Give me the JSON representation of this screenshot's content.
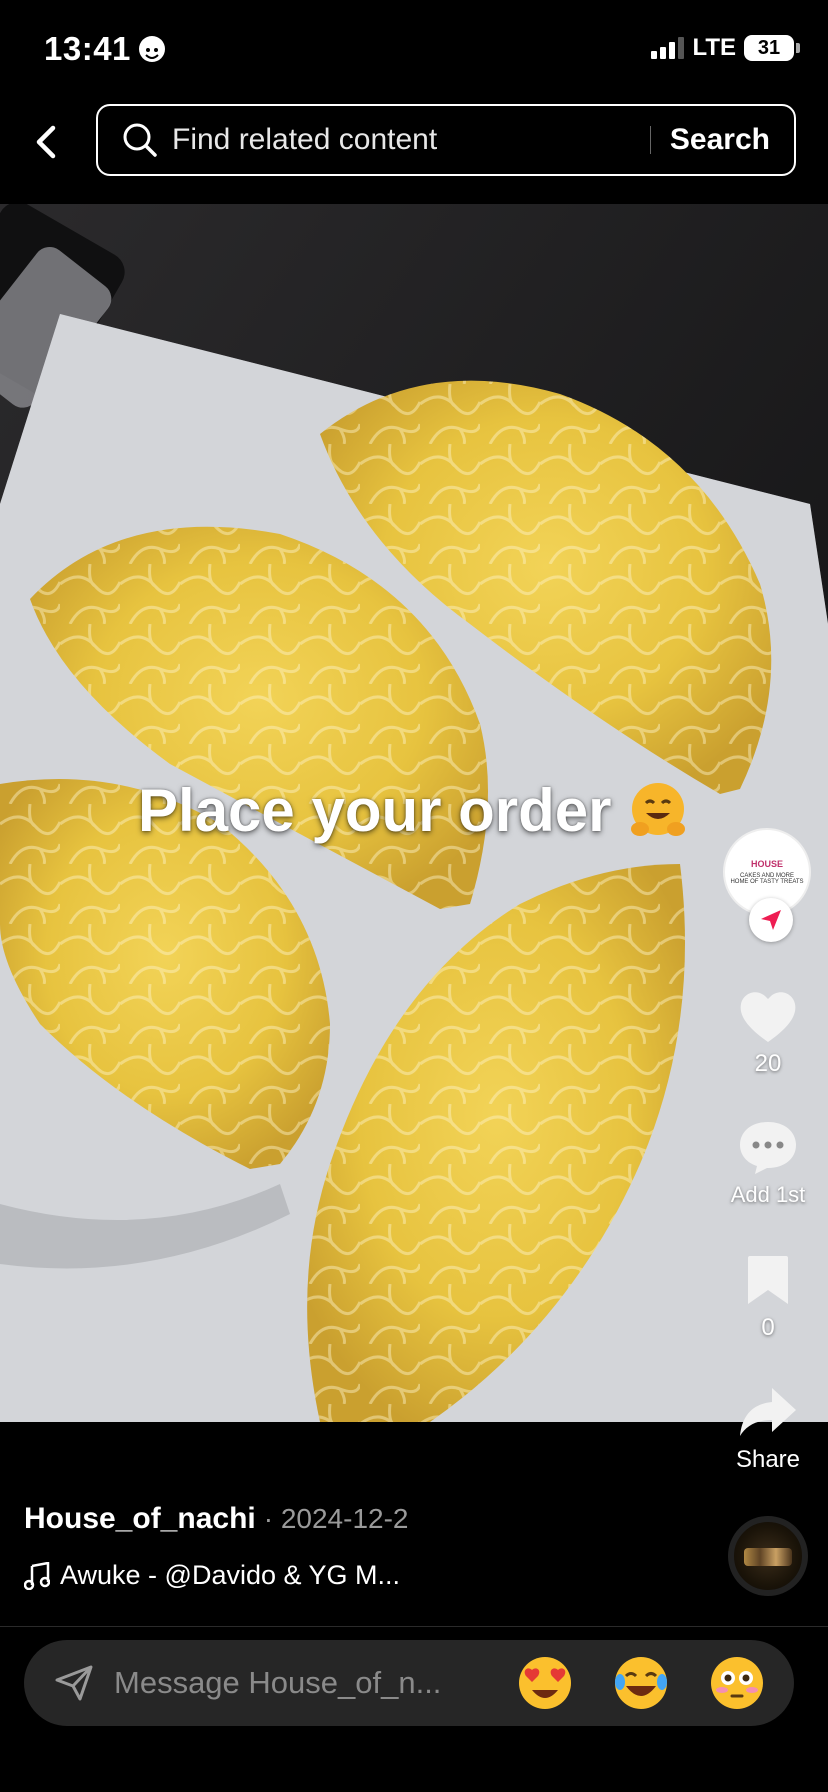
{
  "status_bar": {
    "time": "13:41",
    "network": "LTE",
    "battery": "31"
  },
  "search": {
    "placeholder": "Find related content",
    "button_label": "Search"
  },
  "video": {
    "caption": "Place your order"
  },
  "creator_avatar": {
    "line1": "HOUSE",
    "line2": "CAKES AND MORE",
    "line3": "HOME OF TASTY TREATS"
  },
  "actions": {
    "likes": "20",
    "comments_label": "Add 1st",
    "saves": "0",
    "share_label": "Share"
  },
  "post": {
    "author": "House_of_nachi",
    "date": "· 2024-12-2",
    "sound": "Awuke - @Davido & YG M..."
  },
  "message_bar": {
    "placeholder": "Message House_of_n...",
    "emojis": [
      "heart-eyes-emoji",
      "tears-of-joy-emoji",
      "flushed-emoji"
    ]
  }
}
